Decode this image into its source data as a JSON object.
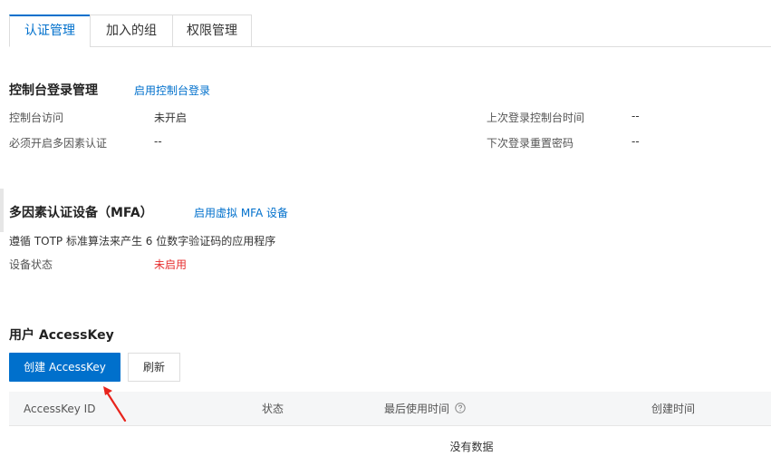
{
  "tabs": [
    {
      "label": "认证管理",
      "active": true
    },
    {
      "label": "加入的组",
      "active": false
    },
    {
      "label": "权限管理",
      "active": false
    }
  ],
  "console_login": {
    "title": "控制台登录管理",
    "action_link": "启用控制台登录",
    "fields": [
      {
        "label": "控制台访问",
        "value": "未开启"
      },
      {
        "label": "必须开启多因素认证",
        "value": "--"
      },
      {
        "label": "上次登录控制台时间",
        "value": "--"
      },
      {
        "label": "下次登录重置密码",
        "value": "--"
      }
    ]
  },
  "mfa": {
    "title": "多因素认证设备（MFA）",
    "action_link": "启用虚拟 MFA 设备",
    "description": "遵循 TOTP 标准算法来产生 6 位数字验证码的应用程序",
    "status_label": "设备状态",
    "status_value": "未启用",
    "status_color": "#e62e2e"
  },
  "accesskey": {
    "title": "用户 AccessKey",
    "create_button": "创建 AccessKey",
    "refresh_button": "刷新",
    "columns": [
      "AccessKey ID",
      "状态",
      "最后使用时间",
      "创建时间"
    ],
    "empty_text": "没有数据"
  },
  "colors": {
    "accent": "#0070cc",
    "danger": "#e62e2e",
    "annotation_arrow": "#e8241c"
  }
}
